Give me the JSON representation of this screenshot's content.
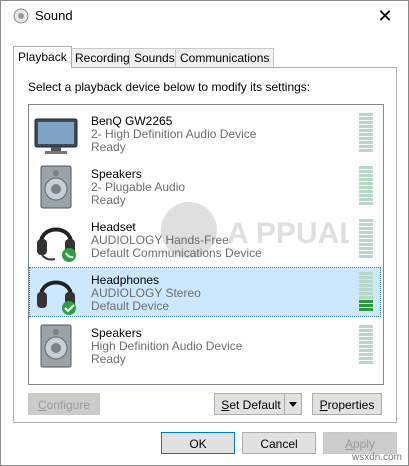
{
  "window": {
    "title": "Sound",
    "close_glyph": "✕"
  },
  "tabs": [
    {
      "label": "Playback",
      "active": true
    },
    {
      "label": "Recording",
      "active": false
    },
    {
      "label": "Sounds",
      "active": false
    },
    {
      "label": "Communications",
      "active": false
    }
  ],
  "panel": {
    "instruction": "Select a playback device below to modify its settings:"
  },
  "devices": [
    {
      "name": "BenQ GW2265",
      "desc": "2- High Definition Audio Device",
      "status": "Ready",
      "icon": "monitor-icon",
      "selected": false,
      "level": 0
    },
    {
      "name": "Speakers",
      "desc": "2- Plugable Audio",
      "status": "Ready",
      "icon": "speaker-icon",
      "selected": false,
      "level": 0
    },
    {
      "name": "Headset",
      "desc": "AUDIOLOGY Hands-Free",
      "status": "Default Communications Device",
      "icon": "headset-icon",
      "badge": "phone-badge-icon",
      "selected": false,
      "level": 0
    },
    {
      "name": "Headphones",
      "desc": "AUDIOLOGY Stereo",
      "status": "Default Device",
      "icon": "headphones-icon",
      "badge": "check-badge-icon",
      "selected": true,
      "level": 0.3
    },
    {
      "name": "Speakers",
      "desc": "High Definition Audio Device",
      "status": "Ready",
      "icon": "speaker-icon",
      "selected": false,
      "level": 0
    }
  ],
  "watermark": {
    "brand": "A PPUALS"
  },
  "buttons": {
    "configure": {
      "label": "Configure",
      "enabled": false
    },
    "set_default": {
      "label": "Set Default",
      "enabled": true
    },
    "properties": {
      "label": "Properties",
      "enabled": true
    },
    "ok": {
      "label": "OK",
      "enabled": true
    },
    "cancel": {
      "label": "Cancel",
      "enabled": true
    },
    "apply": {
      "label": "Apply",
      "enabled": false
    }
  },
  "footer_watermark": "wsxdn.com",
  "colors": {
    "selection": "#cce8ff",
    "meter_idle": "#b7d8c9",
    "meter_active": "#2a9a3a",
    "accent": "#0078d7"
  }
}
